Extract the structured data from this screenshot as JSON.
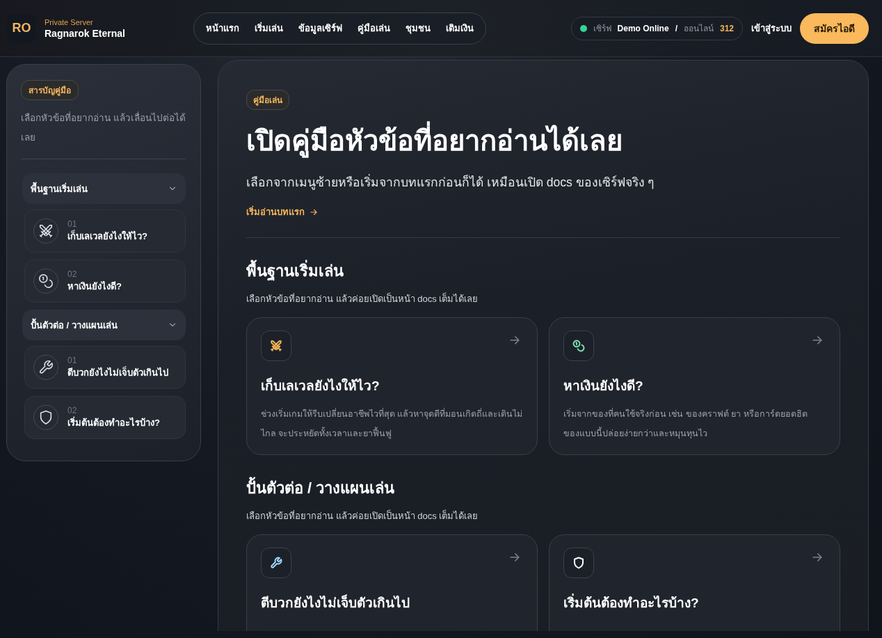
{
  "brand": {
    "logo": "RO",
    "subtitle": "Private Server",
    "name": "Ragnarok Eternal"
  },
  "nav": [
    "หน้าแรก",
    "เริ่มเล่น",
    "ข้อมูลเซิร์ฟ",
    "คู่มือเล่น",
    "ชุมชน",
    "เติมเงิน"
  ],
  "server_status": {
    "online": true,
    "label": "เซิร์ฟ",
    "value": "Demo Online",
    "separator": "/",
    "players_label": "ออนไลน์",
    "players": "312"
  },
  "login": "เข้าสู่ระบบ",
  "register": "สมัครไอดี",
  "sidebar": {
    "badge": "สารบัญคู่มือ",
    "hint": "เลือกหัวข้อที่อยากอ่าน แล้วเลื่อนไปต่อได้เลย",
    "groups": [
      {
        "title": "พื้นฐานเริ่มเล่น",
        "expanded": true,
        "items": [
          {
            "number": "01",
            "title": "เก็บเลเวลยังไงให้ไว?",
            "kind": "swords"
          },
          {
            "number": "02",
            "title": "หาเงินยังไงดี?",
            "kind": "coins"
          }
        ]
      },
      {
        "title": "ปั้นตัวต่อ / วางแผนเล่น",
        "expanded": true,
        "items": [
          {
            "number": "01",
            "title": "ตีบวกยังไงไม่เจ็บตัวเกินไป",
            "kind": "wrench"
          },
          {
            "number": "02",
            "title": "เริ่มต้นต้องทำอะไรบ้าง?",
            "kind": "shield"
          }
        ]
      }
    ]
  },
  "hero": {
    "badge": "คู่มือเล่น",
    "title": "เปิดคู่มือหัวข้อที่อยากอ่านได้เลย",
    "subtitle": "เลือกจากเมนูซ้ายหรือเริ่มจากบทแรกก่อนก็ได้ เหมือนเปิด docs ของเซิร์ฟจริง ๆ",
    "link": "เริ่มอ่านบทแรก"
  },
  "sections": [
    {
      "title": "พื้นฐานเริ่มเล่น",
      "subtitle": "เลือกหัวข้อที่อยากอ่าน แล้วค่อยเปิดเป็นหน้า docs เต็มได้เลย",
      "cards": [
        {
          "kind": "swords",
          "color": "#f5b55c",
          "title": "เก็บเลเวลยังไงให้ไว?",
          "description": "ช่วงเริ่มเกมให้รีบเปลี่ยนอาชีพไวที่สุด แล้วหาจุดตีที่มอนเกิดถี่และเดินไม่ไกล จะประหยัดทั้งเวลาและยาฟื้นฟู"
        },
        {
          "kind": "coins",
          "color": "#7fe0b0",
          "title": "หาเงินยังไงดี?",
          "description": "เริ่มจากของที่คนใช้จริงก่อน เช่น ของคราฟต์ ยา หรือการ์ดยอดฮิต ของแบบนี้ปล่อยง่ายกว่าและหมุนทุนไว"
        }
      ]
    },
    {
      "title": "ปั้นตัวต่อ / วางแผนเล่น",
      "subtitle": "เลือกหัวข้อที่อยากอ่าน แล้วค่อยเปิดเป็นหน้า docs เต็มได้เลย",
      "cards": [
        {
          "kind": "wrench",
          "color": "#9fd6ff",
          "title": "ตีบวกยังไงไม่เจ็บตัวเกินไป"
        },
        {
          "kind": "shield",
          "color": "#ffffff",
          "title": "เริ่มต้นต้องทำอะไรบ้าง?"
        }
      ]
    }
  ]
}
